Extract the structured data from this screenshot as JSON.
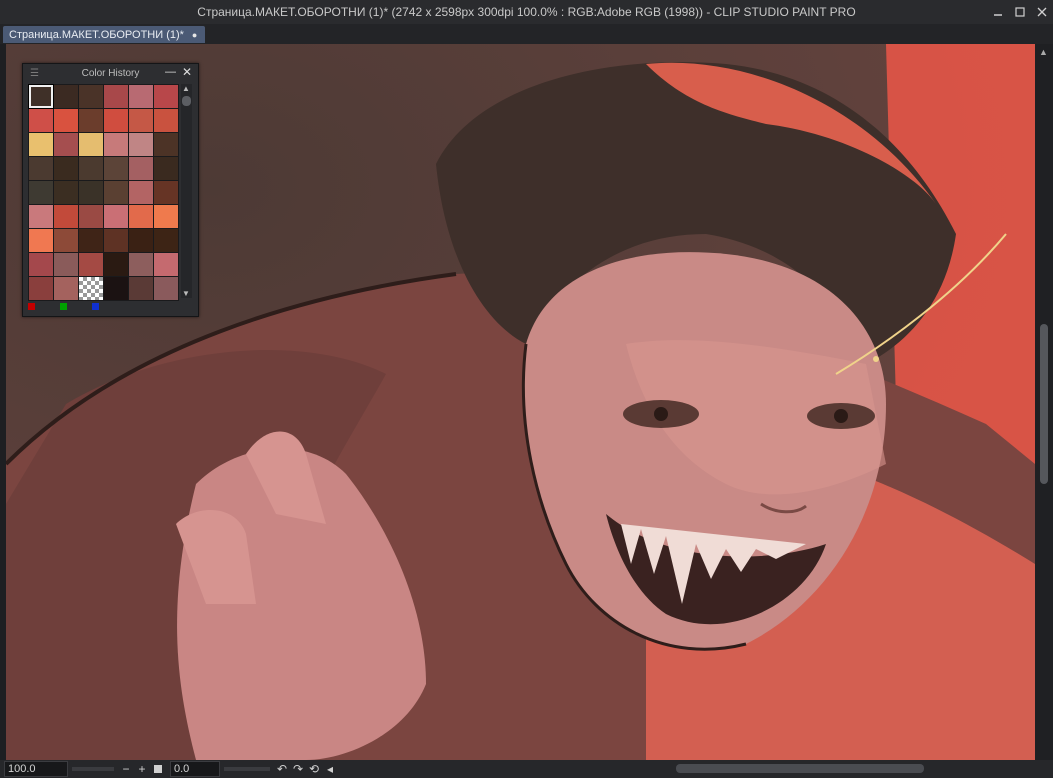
{
  "window": {
    "title": "Страница.МАКЕТ.ОБОРОТНИ (1)* (2742 x 2598px 300dpi 100.0% : RGB:Adobe RGB (1998))  - CLIP STUDIO PAINT PRO",
    "controls": [
      "minimize-icon",
      "maximize-icon",
      "close-icon"
    ]
  },
  "tab": {
    "label": "Страница.МАКЕТ.ОБОРОТНИ (1)*",
    "close_glyph": "●"
  },
  "panel": {
    "title": "Color History",
    "swatches": [
      "#3f3028",
      "#3b2a22",
      "#4a3328",
      "#a8484a",
      "#b86a72",
      "#b8474a",
      "#cf4f48",
      "#d9523f",
      "#6b3d2c",
      "#d04d3f",
      "#c55846",
      "#c9523f",
      "#e9c06e",
      "#a54e4f",
      "#e5bd6f",
      "#c77a7a",
      "#c08585",
      "#4c3326",
      "#4b3a30",
      "#3a2b1f",
      "#4b3a2f",
      "#5c4438",
      "#a46062",
      "#3a2a1f",
      "#3e3a32",
      "#3b2e22",
      "#3a3228",
      "#5a4032",
      "#b36464",
      "#663425",
      "#c9797c",
      "#c24a3a",
      "#9a4a44",
      "#ca6f75",
      "#e26a4b",
      "#ef7a4d",
      "#f07851",
      "#8d4a38",
      "#3f2417",
      "#5e3224",
      "#3a2114",
      "#3d2415",
      "#a4484c",
      "#8a5b5a",
      "#a44a44",
      "#2a1a12",
      "#8d5e5d",
      "#c56a6f",
      "#8a3f3d",
      "#a4625e",
      "transparent",
      "#1b1212",
      "#5a3a36",
      "#8a5a5c"
    ],
    "selected_index": 0,
    "footer_colors": [
      "#c40000",
      "#00a000",
      "#1030d0"
    ]
  },
  "status": {
    "zoom": "100.0",
    "zoom_minus": "−",
    "zoom_plus": "+",
    "rotation": "0.0"
  }
}
